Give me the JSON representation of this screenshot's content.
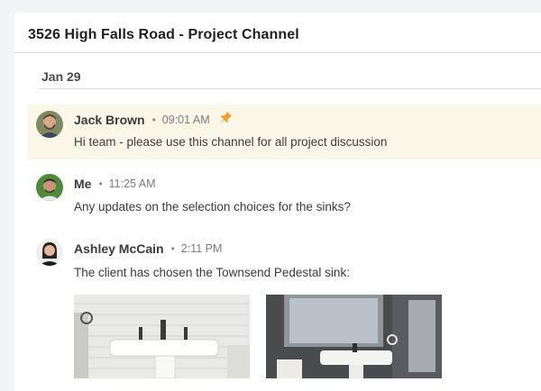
{
  "channel": {
    "title": "3526 High Falls Road - Project Channel"
  },
  "date_divider": "Jan 29",
  "messages": [
    {
      "author": "Jack Brown",
      "time": "09:01 AM",
      "text": "Hi team - please use this channel for all project discussion",
      "pinned": true,
      "pin_icon": "pin-icon"
    },
    {
      "author": "Me",
      "time": "11:25 AM",
      "text": "Any updates on the selection choices for the sinks?",
      "pinned": false
    },
    {
      "author": "Ashley McCain",
      "time": "2:11 PM",
      "text": "The client has chosen the Townsend Pedestal sink:",
      "pinned": false,
      "attachments": [
        "sink-photo-white-tile",
        "sink-photo-grey-bath"
      ]
    }
  ],
  "separator": "•",
  "colors": {
    "pinned_bg": "#fbf7e8",
    "pin_icon": "#f0a030",
    "page_bg": "#f3f4f6"
  }
}
